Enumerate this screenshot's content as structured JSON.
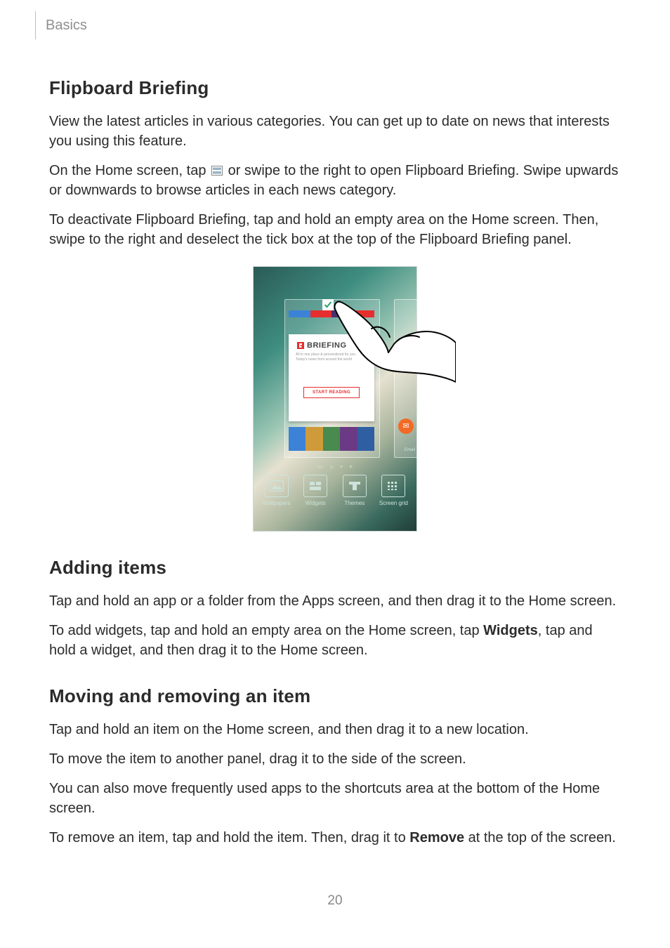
{
  "header": {
    "section": "Basics"
  },
  "h1": "Flipboard Briefing",
  "p1": "View the latest articles in various categories. You can get up to date on news that interests you using this feature.",
  "p2a": "On the Home screen, tap ",
  "p2b": " or swipe to the right to open Flipboard Briefing. Swipe upwards or downwards to browse articles in each news category.",
  "p3": "To deactivate Flipboard Briefing, tap and hold an empty area on the Home screen. Then, swipe to the right and deselect the tick box at the top of the Flipboard Briefing panel.",
  "illus": {
    "card_title": "BRIEFING",
    "card_sub1": "All in one place & personalized for you",
    "card_sub2": "Today's news from around the world",
    "card_button": "START READING",
    "right_label": "Email",
    "strip_colors": [
      "#3c82d6",
      "#e62e2e",
      "#4d2f6f",
      "#e62e2e"
    ],
    "strip2_colors": [
      "#3c82d6",
      "#cf9b3a",
      "#498a4f",
      "#6b3a84",
      "#2f5ea3"
    ],
    "bottom": [
      "Wallpapers",
      "Widgets",
      "Themes",
      "Screen grid"
    ]
  },
  "h2": "Adding items",
  "p4": "Tap and hold an app or a folder from the Apps screen, and then drag it to the Home screen.",
  "p5a": "To add widgets, tap and hold an empty area on the Home screen, tap ",
  "p5bold": "Widgets",
  "p5b": ", tap and hold a widget, and then drag it to the Home screen.",
  "h3": "Moving and removing an item",
  "p6": "Tap and hold an item on the Home screen, and then drag it to a new location.",
  "p7": "To move the item to another panel, drag it to the side of the screen.",
  "p8": "You can also move frequently used apps to the shortcuts area at the bottom of the Home screen.",
  "p9a": "To remove an item, tap and hold the item. Then, drag it to ",
  "p9bold": "Remove",
  "p9b": " at the top of the screen.",
  "page_number": "20"
}
